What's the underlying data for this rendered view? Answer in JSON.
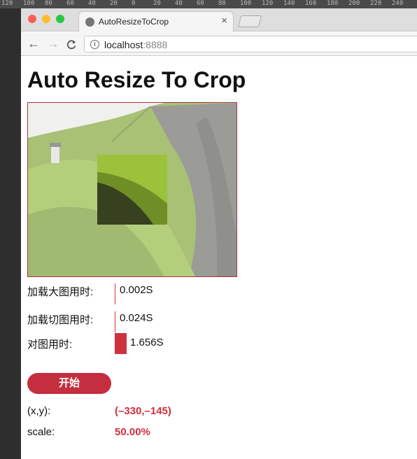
{
  "ruler": {
    "ticks": [
      "120",
      "100",
      "80",
      "60",
      "40",
      "20",
      "0",
      "20",
      "40",
      "60",
      "80",
      "100",
      "120",
      "140",
      "160",
      "180",
      "200",
      "220",
      "240"
    ]
  },
  "window": {
    "tab": {
      "title": "AutoResizeToCrop",
      "close_label": "×"
    },
    "toolbar": {
      "back": "←",
      "forward": "→",
      "reload": "C",
      "info": "i",
      "url_host": "localhost",
      "url_port": ":8888"
    }
  },
  "page": {
    "title": "Auto Resize To Crop",
    "stats": [
      {
        "label": "加载大图用时:",
        "value": "0.002S"
      },
      {
        "label": "加载切图用时:",
        "value": "0.024S"
      },
      {
        "label": "对图用时:",
        "value": "1.656S"
      }
    ],
    "start_button": "开始",
    "coords": {
      "label": "(x,y):",
      "value": "(–330,–145)"
    },
    "scale": {
      "label": "scale:",
      "value": "50.00%"
    }
  },
  "colors": {
    "accent": "#c42e3f",
    "grass": "#7fa434",
    "cliff": "#6c6c66",
    "sky": "#e9eae6"
  },
  "icons": {
    "tab": "site-favicon-icon",
    "info": "info-icon",
    "back": "back-arrow-icon",
    "forward": "forward-arrow-icon",
    "reload": "reload-icon"
  }
}
